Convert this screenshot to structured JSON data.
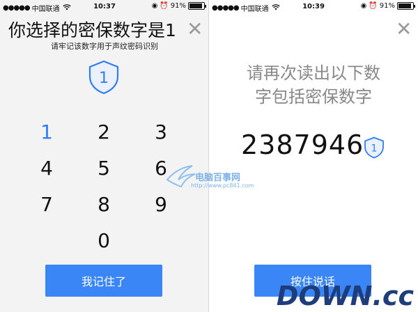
{
  "left_screen": {
    "status_bar": {
      "carrier": "中国联通",
      "time": "10:37",
      "battery": "91%",
      "battery_level": 0.91
    },
    "title": "你选择的密保数字是1",
    "subtitle": "请牢记该数字用于声纹密码识别",
    "shield_number": "1",
    "keypad": {
      "keys": [
        "1",
        "2",
        "3",
        "4",
        "5",
        "6",
        "7",
        "8",
        "9",
        "0"
      ],
      "selected": "1"
    },
    "button_label": "我记住了"
  },
  "right_screen": {
    "status_bar": {
      "carrier": "中国联通",
      "time": "10:39",
      "battery": "91%",
      "battery_level": 0.91
    },
    "prompt_line1": "请再次读出以下数",
    "prompt_line2": "字包括密保数字",
    "digits": "2387946",
    "shield_number": "1",
    "button_label": "按住说话"
  },
  "watermarks": {
    "center_text": "电脑百事网",
    "center_url": "http://www.pc841.com",
    "corner_main": "DOWN",
    "corner_suffix": ".cc"
  },
  "colors": {
    "accent": "#3a86f6",
    "shield_blue": "#2f7cf6",
    "prompt_gray": "#888888",
    "watermark": "#1f3d7a"
  },
  "icons": {
    "close": "close-icon",
    "shield": "shield-icon",
    "wifi": "wifi-icon",
    "battery": "battery-icon"
  }
}
